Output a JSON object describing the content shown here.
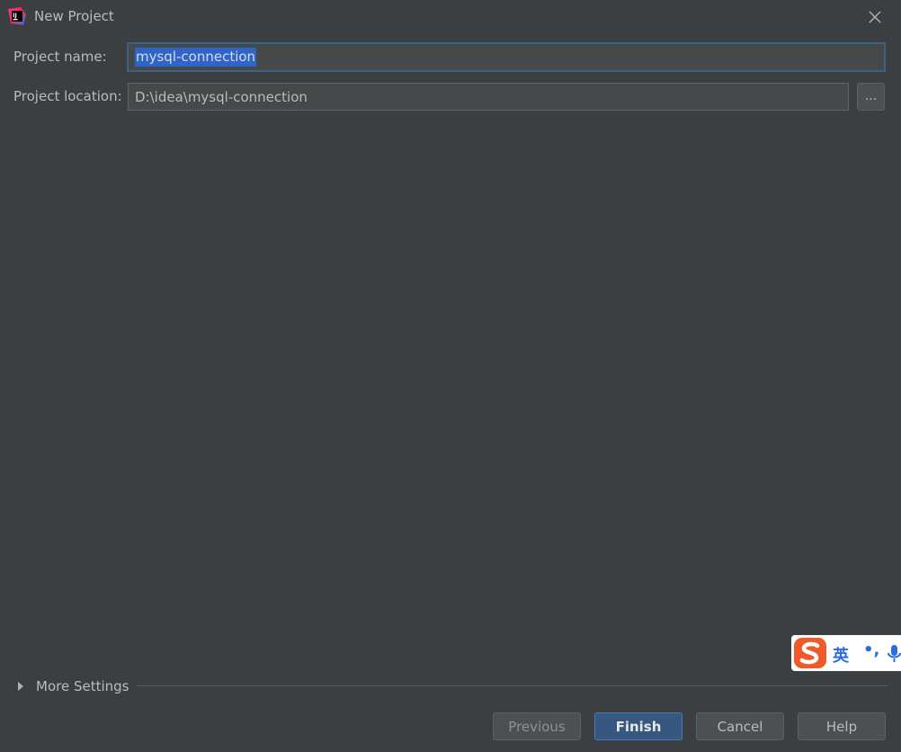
{
  "window": {
    "title": "New Project",
    "icon": "intellij-idea-icon",
    "close_icon": "close-icon"
  },
  "form": {
    "project_name_label": "Project name:",
    "project_name_value": "mysql-connection",
    "project_location_label": "Project location:",
    "project_location_value": "D:\\idea\\mysql-connection",
    "browse_label": "..."
  },
  "more_settings": {
    "label": "More Settings",
    "expanded": false
  },
  "buttons": {
    "previous": "Previous",
    "finish": "Finish",
    "cancel": "Cancel",
    "help": "Help"
  },
  "ime_toolbar": {
    "logo": "sogou-s-icon",
    "language": "英",
    "punctuation": "•,",
    "mic": "microphone-icon"
  },
  "colors": {
    "background": "#3c3f41",
    "field_background": "#45494a",
    "focus_border": "#3d6185",
    "selection": "#2f65ca",
    "default_button": "#365880",
    "ime_accent": "#2d6be0",
    "ime_logo": "#f05a28"
  }
}
